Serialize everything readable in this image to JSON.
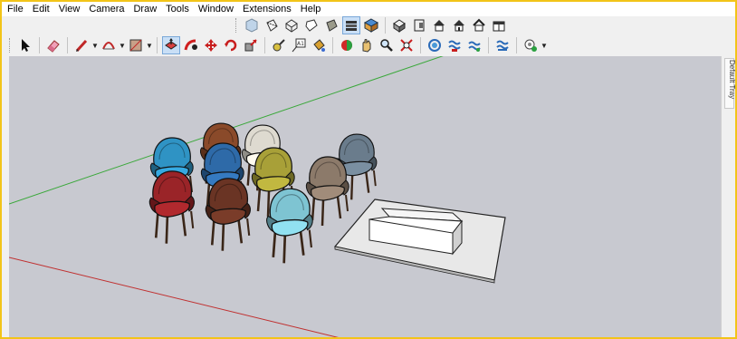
{
  "menu": [
    "File",
    "Edit",
    "View",
    "Camera",
    "Draw",
    "Tools",
    "Window",
    "Extensions",
    "Help"
  ],
  "tray": {
    "label": "Default Tray"
  },
  "colors": {
    "accent_border": "#f2c418",
    "viewport_bg": "#c8c9d0",
    "red_axis": "#c03030",
    "green_axis": "#3aa83a"
  },
  "toolbar_top": {
    "view_styles": [
      "xray-icon",
      "back-edges-icon",
      "wireframe-icon",
      "hidden-line-icon",
      "shaded-icon",
      "shaded-textures-icon",
      "monochrome-icon"
    ],
    "views": [
      "iso-view-icon",
      "top-view-icon",
      "front-view-icon",
      "right-view-icon",
      "back-view-icon",
      "left-view-icon"
    ]
  },
  "toolbar_main": {
    "tools": [
      "select-icon",
      "eraser-icon",
      "pencil-icon",
      "arc-icon",
      "rectangle-icon",
      "push-pull-icon",
      "follow-me-icon",
      "move-icon",
      "rotate-icon",
      "scale-icon",
      "tape-measure-icon",
      "text-icon",
      "paint-bucket-icon",
      "orbit-icon",
      "pan-icon",
      "zoom-icon",
      "zoom-extents-icon",
      "warehouse-icon",
      "extension-warehouse-icon",
      "layout-icon",
      "sandbox-icon",
      "geo-location-icon"
    ]
  },
  "scene": {
    "chairs": [
      {
        "name": "blue-chair",
        "color": "#2f93c4"
      },
      {
        "name": "brown-chair",
        "color": "#8a4a2a"
      },
      {
        "name": "cream-chair",
        "color": "#dedad0"
      },
      {
        "name": "grey-chair",
        "color": "#6a7c8c"
      },
      {
        "name": "navy-chair",
        "color": "#2e6aa8"
      },
      {
        "name": "olive-chair",
        "color": "#a8a038"
      },
      {
        "name": "taupe-chair",
        "color": "#8c7a6a"
      },
      {
        "name": "red-chair",
        "color": "#9a2428"
      },
      {
        "name": "dark-brown-chair",
        "color": "#6a3424"
      },
      {
        "name": "cyan-chair",
        "color": "#7ec4d2"
      }
    ],
    "platform_color": "#ececec",
    "table_color": "#ffffff"
  }
}
